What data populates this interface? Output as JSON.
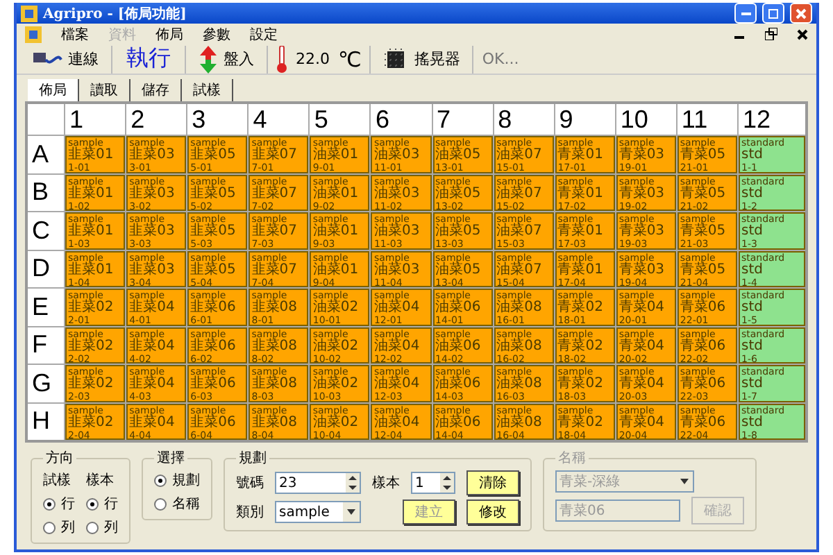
{
  "window": {
    "title": "Agripro - [佈局功能]"
  },
  "menu": [
    {
      "label": "檔案",
      "disabled": false
    },
    {
      "label": "資料",
      "disabled": true
    },
    {
      "label": "佈局",
      "disabled": false
    },
    {
      "label": "參數",
      "disabled": false
    },
    {
      "label": "設定",
      "disabled": false
    }
  ],
  "toolbar": {
    "connect": "連線",
    "run": "執行",
    "load": "盤入",
    "temperature": "22.0",
    "unit": "℃",
    "shaker": "搖晃器",
    "status": "OK..."
  },
  "tabs": [
    {
      "label": "佈局",
      "selected": true
    },
    {
      "label": "讀取",
      "selected": false
    },
    {
      "label": "儲存",
      "selected": false
    },
    {
      "label": "試樣",
      "selected": false
    }
  ],
  "grid": {
    "columns": [
      "1",
      "2",
      "3",
      "4",
      "5",
      "6",
      "7",
      "8",
      "9",
      "10",
      "11",
      "12"
    ],
    "rows": [
      {
        "label": "A",
        "cells": [
          {
            "kind": "sample",
            "text": [
              "sample",
              "韭菜01",
              "1-01"
            ]
          },
          {
            "kind": "sample",
            "text": [
              "sample",
              "韭菜03",
              "3-01"
            ]
          },
          {
            "kind": "sample",
            "text": [
              "sample",
              "韭菜05",
              "5-01"
            ]
          },
          {
            "kind": "sample",
            "text": [
              "sample",
              "韭菜07",
              "7-01"
            ]
          },
          {
            "kind": "sample",
            "text": [
              "sample",
              "油菜01",
              "9-01"
            ]
          },
          {
            "kind": "sample",
            "text": [
              "sample",
              "油菜03",
              "11-01"
            ]
          },
          {
            "kind": "sample",
            "text": [
              "sample",
              "油菜05",
              "13-01"
            ]
          },
          {
            "kind": "sample",
            "text": [
              "sample",
              "油菜07",
              "15-01"
            ]
          },
          {
            "kind": "sample",
            "text": [
              "sample",
              "青菜01",
              "17-01"
            ]
          },
          {
            "kind": "sample",
            "text": [
              "sample",
              "青菜03",
              "19-01"
            ]
          },
          {
            "kind": "sample",
            "text": [
              "sample",
              "青菜05",
              "21-01"
            ]
          },
          {
            "kind": "standard",
            "text": [
              "standard",
              "std",
              "1-1"
            ]
          }
        ]
      },
      {
        "label": "B",
        "cells": [
          {
            "kind": "sample",
            "text": [
              "sample",
              "韭菜01",
              "1-02"
            ]
          },
          {
            "kind": "sample",
            "text": [
              "sample",
              "韭菜03",
              "3-02"
            ]
          },
          {
            "kind": "sample",
            "text": [
              "sample",
              "韭菜05",
              "5-02"
            ]
          },
          {
            "kind": "sample",
            "text": [
              "sample",
              "韭菜07",
              "7-02"
            ]
          },
          {
            "kind": "sample",
            "text": [
              "sample",
              "油菜01",
              "9-02"
            ]
          },
          {
            "kind": "sample",
            "text": [
              "sample",
              "油菜03",
              "11-02"
            ]
          },
          {
            "kind": "sample",
            "text": [
              "sample",
              "油菜05",
              "13-02"
            ]
          },
          {
            "kind": "sample",
            "text": [
              "sample",
              "油菜07",
              "15-02"
            ]
          },
          {
            "kind": "sample",
            "text": [
              "sample",
              "青菜01",
              "17-02"
            ]
          },
          {
            "kind": "sample",
            "text": [
              "sample",
              "青菜03",
              "19-02"
            ]
          },
          {
            "kind": "sample",
            "text": [
              "sample",
              "青菜05",
              "21-02"
            ]
          },
          {
            "kind": "standard",
            "text": [
              "standard",
              "std",
              "1-2"
            ]
          }
        ]
      },
      {
        "label": "C",
        "cells": [
          {
            "kind": "sample",
            "text": [
              "sample",
              "韭菜01",
              "1-03"
            ]
          },
          {
            "kind": "sample",
            "text": [
              "sample",
              "韭菜03",
              "3-03"
            ]
          },
          {
            "kind": "sample",
            "text": [
              "sample",
              "韭菜05",
              "5-03"
            ]
          },
          {
            "kind": "sample",
            "text": [
              "sample",
              "韭菜07",
              "7-03"
            ]
          },
          {
            "kind": "sample",
            "text": [
              "sample",
              "油菜01",
              "9-03"
            ]
          },
          {
            "kind": "sample",
            "text": [
              "sample",
              "油菜03",
              "11-03"
            ]
          },
          {
            "kind": "sample",
            "text": [
              "sample",
              "油菜05",
              "13-03"
            ]
          },
          {
            "kind": "sample",
            "text": [
              "sample",
              "油菜07",
              "15-03"
            ]
          },
          {
            "kind": "sample",
            "text": [
              "sample",
              "青菜01",
              "17-03"
            ]
          },
          {
            "kind": "sample",
            "text": [
              "sample",
              "青菜03",
              "19-03"
            ]
          },
          {
            "kind": "sample",
            "text": [
              "sample",
              "青菜05",
              "21-03"
            ]
          },
          {
            "kind": "standard",
            "text": [
              "standard",
              "std",
              "1-3"
            ]
          }
        ]
      },
      {
        "label": "D",
        "cells": [
          {
            "kind": "sample",
            "text": [
              "sample",
              "韭菜01",
              "1-04"
            ]
          },
          {
            "kind": "sample",
            "text": [
              "sample",
              "韭菜03",
              "3-04"
            ]
          },
          {
            "kind": "sample",
            "text": [
              "sample",
              "韭菜05",
              "5-04"
            ]
          },
          {
            "kind": "sample",
            "text": [
              "sample",
              "韭菜07",
              "7-04"
            ]
          },
          {
            "kind": "sample",
            "text": [
              "sample",
              "油菜01",
              "9-04"
            ]
          },
          {
            "kind": "sample",
            "text": [
              "sample",
              "油菜03",
              "11-04"
            ]
          },
          {
            "kind": "sample",
            "text": [
              "sample",
              "油菜05",
              "13-04"
            ]
          },
          {
            "kind": "sample",
            "text": [
              "sample",
              "油菜07",
              "15-04"
            ]
          },
          {
            "kind": "sample",
            "text": [
              "sample",
              "青菜01",
              "17-04"
            ]
          },
          {
            "kind": "sample",
            "text": [
              "sample",
              "青菜03",
              "19-04"
            ]
          },
          {
            "kind": "sample",
            "text": [
              "sample",
              "青菜05",
              "21-04"
            ]
          },
          {
            "kind": "standard",
            "text": [
              "standard",
              "std",
              "1-4"
            ]
          }
        ]
      },
      {
        "label": "E",
        "cells": [
          {
            "kind": "sample",
            "text": [
              "sample",
              "韭菜02",
              "2-01"
            ]
          },
          {
            "kind": "sample",
            "text": [
              "sample",
              "韭菜04",
              "4-01"
            ]
          },
          {
            "kind": "sample",
            "text": [
              "sample",
              "韭菜06",
              "6-01"
            ]
          },
          {
            "kind": "sample",
            "text": [
              "sample",
              "韭菜08",
              "8-01"
            ]
          },
          {
            "kind": "sample",
            "text": [
              "sample",
              "油菜02",
              "10-01"
            ]
          },
          {
            "kind": "sample",
            "text": [
              "sample",
              "油菜04",
              "12-01"
            ]
          },
          {
            "kind": "sample",
            "text": [
              "sample",
              "油菜06",
              "14-01"
            ]
          },
          {
            "kind": "sample",
            "text": [
              "sample",
              "油菜08",
              "16-01"
            ]
          },
          {
            "kind": "sample",
            "text": [
              "sample",
              "青菜02",
              "18-01"
            ]
          },
          {
            "kind": "sample",
            "text": [
              "sample",
              "青菜04",
              "20-01"
            ]
          },
          {
            "kind": "sample",
            "text": [
              "sample",
              "青菜06",
              "22-01"
            ]
          },
          {
            "kind": "standard",
            "text": [
              "standard",
              "std",
              "1-5"
            ]
          }
        ]
      },
      {
        "label": "F",
        "cells": [
          {
            "kind": "sample",
            "text": [
              "sample",
              "韭菜02",
              "2-02"
            ]
          },
          {
            "kind": "sample",
            "text": [
              "sample",
              "韭菜04",
              "4-02"
            ]
          },
          {
            "kind": "sample",
            "text": [
              "sample",
              "韭菜06",
              "6-02"
            ]
          },
          {
            "kind": "sample",
            "text": [
              "sample",
              "韭菜08",
              "8-02"
            ]
          },
          {
            "kind": "sample",
            "text": [
              "sample",
              "油菜02",
              "10-02"
            ]
          },
          {
            "kind": "sample",
            "text": [
              "sample",
              "油菜04",
              "12-02"
            ]
          },
          {
            "kind": "sample",
            "text": [
              "sample",
              "油菜06",
              "14-02"
            ]
          },
          {
            "kind": "sample",
            "text": [
              "sample",
              "油菜08",
              "16-02"
            ]
          },
          {
            "kind": "sample",
            "text": [
              "sample",
              "青菜02",
              "18-02"
            ]
          },
          {
            "kind": "sample",
            "text": [
              "sample",
              "青菜04",
              "20-02"
            ]
          },
          {
            "kind": "sample",
            "text": [
              "sample",
              "青菜06",
              "22-02"
            ]
          },
          {
            "kind": "standard",
            "text": [
              "standard",
              "std",
              "1-6"
            ]
          }
        ]
      },
      {
        "label": "G",
        "cells": [
          {
            "kind": "sample",
            "text": [
              "sample",
              "韭菜02",
              "2-03"
            ]
          },
          {
            "kind": "sample",
            "text": [
              "sample",
              "韭菜04",
              "4-03"
            ]
          },
          {
            "kind": "sample",
            "text": [
              "sample",
              "韭菜06",
              "6-03"
            ]
          },
          {
            "kind": "sample",
            "text": [
              "sample",
              "韭菜08",
              "8-03"
            ]
          },
          {
            "kind": "sample",
            "text": [
              "sample",
              "油菜02",
              "10-03"
            ]
          },
          {
            "kind": "sample",
            "text": [
              "sample",
              "油菜04",
              "12-03"
            ]
          },
          {
            "kind": "sample",
            "text": [
              "sample",
              "油菜06",
              "14-03"
            ]
          },
          {
            "kind": "sample",
            "text": [
              "sample",
              "油菜08",
              "16-03"
            ]
          },
          {
            "kind": "sample",
            "text": [
              "sample",
              "青菜02",
              "18-03"
            ]
          },
          {
            "kind": "sample",
            "text": [
              "sample",
              "青菜04",
              "20-03"
            ]
          },
          {
            "kind": "sample",
            "text": [
              "sample",
              "青菜06",
              "22-03"
            ]
          },
          {
            "kind": "standard",
            "text": [
              "standard",
              "std",
              "1-7"
            ]
          }
        ]
      },
      {
        "label": "H",
        "cells": [
          {
            "kind": "sample",
            "text": [
              "sample",
              "韭菜02",
              "2-04"
            ]
          },
          {
            "kind": "sample",
            "text": [
              "sample",
              "韭菜04",
              "4-04"
            ]
          },
          {
            "kind": "sample",
            "text": [
              "sample",
              "韭菜06",
              "6-04"
            ]
          },
          {
            "kind": "sample",
            "text": [
              "sample",
              "韭菜08",
              "8-04"
            ]
          },
          {
            "kind": "sample",
            "text": [
              "sample",
              "油菜02",
              "10-04"
            ]
          },
          {
            "kind": "sample",
            "text": [
              "sample",
              "油菜04",
              "12-04"
            ]
          },
          {
            "kind": "sample",
            "text": [
              "sample",
              "油菜06",
              "14-04"
            ]
          },
          {
            "kind": "sample",
            "text": [
              "sample",
              "油菜08",
              "16-04"
            ]
          },
          {
            "kind": "sample",
            "text": [
              "sample",
              "青菜02",
              "18-04"
            ]
          },
          {
            "kind": "sample",
            "text": [
              "sample",
              "青菜04",
              "20-04"
            ]
          },
          {
            "kind": "sample",
            "text": [
              "sample",
              "青菜06",
              "22-04"
            ]
          },
          {
            "kind": "standard",
            "text": [
              "standard",
              "std",
              "1-8"
            ]
          }
        ]
      }
    ]
  },
  "direction": {
    "title": "方向",
    "groups": [
      {
        "label": "試樣",
        "options": [
          {
            "label": "行",
            "selected": true
          },
          {
            "label": "列",
            "selected": false
          }
        ]
      },
      {
        "label": "樣本",
        "options": [
          {
            "label": "行",
            "selected": true
          },
          {
            "label": "列",
            "selected": false
          }
        ]
      }
    ]
  },
  "select": {
    "title": "選擇",
    "options": [
      {
        "label": "規劃",
        "selected": true
      },
      {
        "label": "名稱",
        "selected": false
      }
    ]
  },
  "plan": {
    "title": "規劃",
    "number_label": "號碼",
    "number": "23",
    "sample_label": "樣本",
    "sample": "1",
    "category_label": "類別",
    "category": "sample",
    "buttons": [
      {
        "label": "清除",
        "disabled": false
      },
      {
        "label": "建立",
        "disabled": true
      },
      {
        "label": "修改",
        "disabled": false
      }
    ]
  },
  "name": {
    "title": "名稱",
    "disabled": true,
    "dropdown": "青菜-深綠",
    "field": "青菜06",
    "button": "確認"
  }
}
